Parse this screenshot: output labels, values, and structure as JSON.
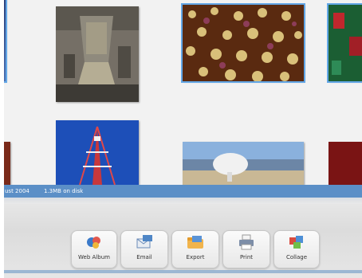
{
  "status_bar": {
    "left_text": "ust 2004",
    "disk_text": "1.3MB on disk"
  },
  "photos": [
    {
      "name": "photo-left-edge-top",
      "selected": true
    },
    {
      "name": "photo-spacecraft",
      "selected": false
    },
    {
      "name": "photo-cds",
      "selected": true
    },
    {
      "name": "photo-right-edge-top",
      "selected": true
    },
    {
      "name": "photo-left-edge-bottom",
      "selected": false
    },
    {
      "name": "photo-tower",
      "selected": false
    },
    {
      "name": "photo-dish",
      "selected": false
    },
    {
      "name": "photo-right-edge-bottom",
      "selected": false
    }
  ],
  "toolbar": {
    "buttons": [
      {
        "label": "Web Album",
        "icon": "web-album-icon"
      },
      {
        "label": "Email",
        "icon": "email-icon"
      },
      {
        "label": "Export",
        "icon": "export-icon"
      },
      {
        "label": "Print",
        "icon": "print-icon"
      },
      {
        "label": "Collage",
        "icon": "collage-icon"
      }
    ]
  },
  "colors": {
    "status_bar": "#5b8fc7",
    "selection": "#62a6e6"
  }
}
